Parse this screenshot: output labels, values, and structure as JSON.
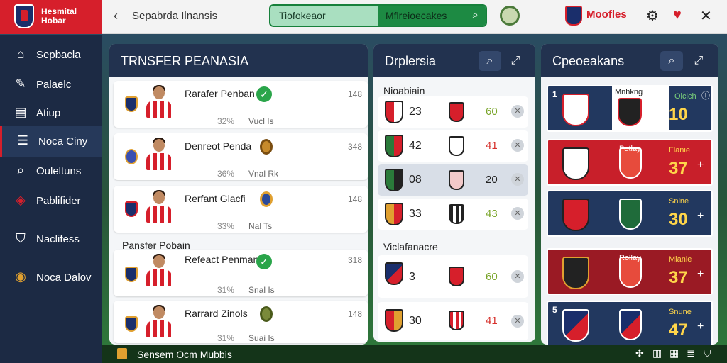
{
  "app": {
    "title": "Hesmital Hobar"
  },
  "header": {
    "breadcrumb": "Sepabrda Ilnansis",
    "search": {
      "value": "Tiofokeaor",
      "placeholder": "Tiofokeaor",
      "right_label": "Mflreioecakes"
    },
    "user_label": "Moofles"
  },
  "sidebar": {
    "items": [
      {
        "label": "Sepbacla",
        "icon": "home-icon"
      },
      {
        "label": "Palaelc",
        "icon": "tools-icon"
      },
      {
        "label": "Atiup",
        "icon": "building-icon"
      },
      {
        "label": "Noca Ciny",
        "icon": "list-icon"
      },
      {
        "label": "Ouleltuns",
        "icon": "search-icon"
      },
      {
        "label": "Pablifider",
        "icon": "club-icon"
      },
      {
        "label": "Naclifess",
        "icon": "shield-icon"
      },
      {
        "label": "Noca Dalov",
        "icon": "badge-icon"
      }
    ]
  },
  "transfer": {
    "title": "TRNSFER PEANASIA",
    "section_label": "Pansfer Pobain",
    "rows": [
      {
        "name": "Rarafer Penban",
        "pct": "32%",
        "status": "Vucl Is",
        "num": "148",
        "indicator": "check"
      },
      {
        "name": "Denreot Penda",
        "pct": "36%",
        "status": "Vnal Rk",
        "num": "348",
        "indicator": "coin"
      },
      {
        "name": "Rerfant Glacfi",
        "pct": "33%",
        "status": "Nal Ts",
        "num": "148",
        "indicator": "coin"
      },
      {
        "name": "Refeact Penman",
        "pct": "31%",
        "status": "Snal Is",
        "num": "318",
        "indicator": "check"
      },
      {
        "name": "Rarrard Zinols",
        "pct": "31%",
        "status": "Suai Is",
        "num": "148",
        "indicator": "coin"
      }
    ]
  },
  "matches": {
    "title": "Drplersia",
    "section1": "Nioabiain",
    "section2": "Viclafanacre",
    "rows": [
      {
        "score": "23",
        "value": "60",
        "value_color": "#7aa52a"
      },
      {
        "score": "42",
        "value": "41",
        "value_color": "#d6302b"
      },
      {
        "score": "08",
        "value": "20",
        "value_color": "#222222"
      },
      {
        "score": "33",
        "value": "43",
        "value_color": "#7aa52a"
      },
      {
        "score": "3",
        "value": "60",
        "value_color": "#7aa52a"
      },
      {
        "score": "30",
        "value": "41",
        "value_color": "#d6302b"
      }
    ]
  },
  "standings": {
    "title": "Cpeoeakans",
    "header_card": {
      "num": "1",
      "label": "Mnhkng",
      "stat_label": "Olcich",
      "value": "10"
    },
    "cards": [
      {
        "num": "",
        "label": "Potlay",
        "stat_label": "Flanie",
        "value": "37",
        "color": "#c81f2a"
      },
      {
        "num": "",
        "label": "",
        "stat_label": "Snine",
        "value": "30",
        "color": "#22385f"
      },
      {
        "num": "",
        "label": "Rollay",
        "stat_label": "Mianie",
        "value": "37",
        "color": "#9a1a24"
      },
      {
        "num": "5",
        "label": "",
        "stat_label": "Snune",
        "value": "47",
        "color": "#22385f"
      }
    ]
  },
  "footer": {
    "text": "Sensem Ocm Mubbis"
  }
}
